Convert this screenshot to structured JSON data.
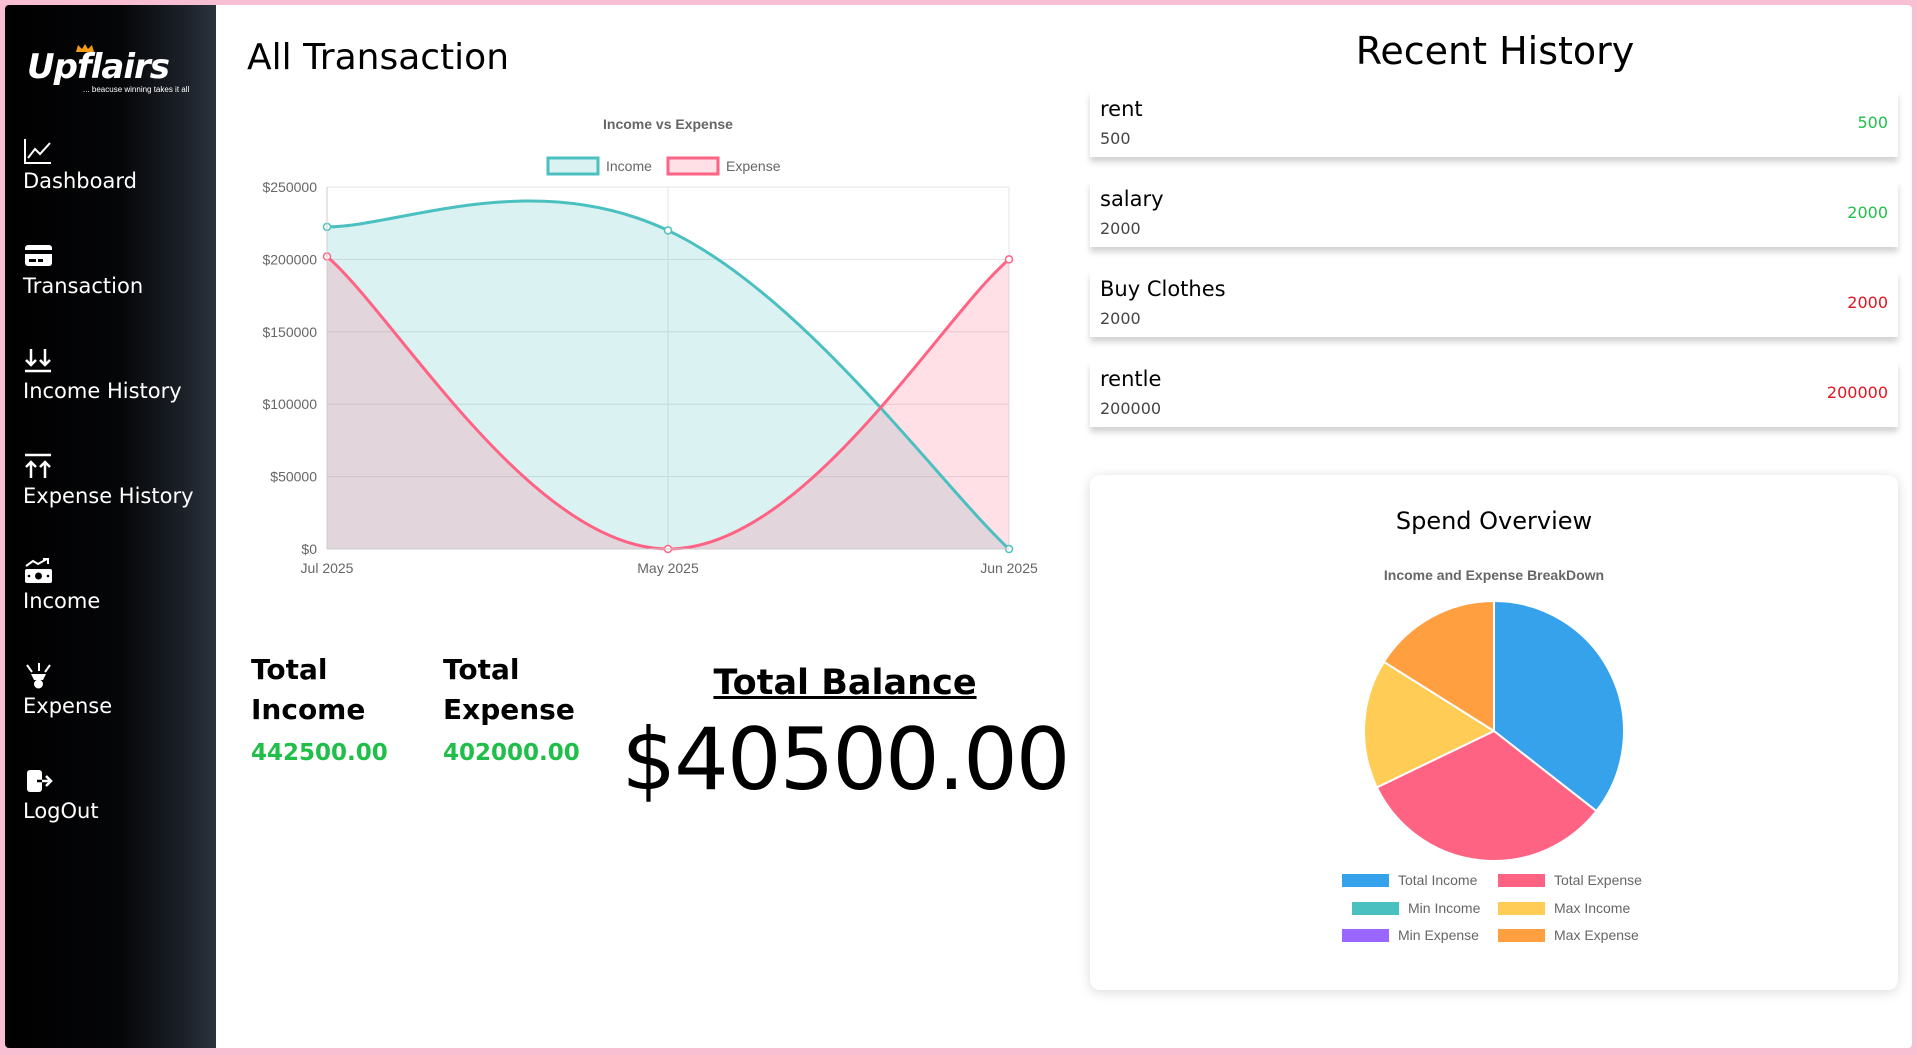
{
  "app": {
    "brand": "UpFlairs",
    "brand_display": "Upflairs",
    "tagline": "... beacuse winning takes it all"
  },
  "sidebar": {
    "items": [
      {
        "label": "Dashboard",
        "icon": "line-chart-icon"
      },
      {
        "label": "Transaction",
        "icon": "credit-card-icon"
      },
      {
        "label": "Income History",
        "icon": "download-arrows-icon"
      },
      {
        "label": "Expense History",
        "icon": "upload-arrows-icon"
      },
      {
        "label": "Income",
        "icon": "money-stack-icon"
      },
      {
        "label": "Expense",
        "icon": "hand-coins-icon"
      },
      {
        "label": "LogOut",
        "icon": "logout-icon"
      }
    ]
  },
  "main": {
    "title": "All Transaction",
    "totals": {
      "income_label": "Total Income",
      "income_value": "442500.00",
      "expense_label": "Total Expense",
      "expense_value": "402000.00",
      "balance_label": "Total Balance",
      "balance_value": "$40500.00"
    }
  },
  "chart_data": [
    {
      "type": "area",
      "title": "Income vs Expense",
      "categories": [
        "Jul 2025",
        "May 2025",
        "Jun 2025"
      ],
      "series": [
        {
          "name": "Income",
          "values": [
            222500,
            220000,
            0
          ],
          "color": "#4bc0c0"
        },
        {
          "name": "Expense",
          "values": [
            202000,
            0,
            200000
          ],
          "color": "#ff6384"
        }
      ],
      "ylim": [
        0,
        250000
      ],
      "yticks": [
        "$0",
        "$50000",
        "$100000",
        "$150000",
        "$200000",
        "$250000"
      ],
      "legend": "top",
      "grid": true
    },
    {
      "type": "pie",
      "title": "Income and Expense BreakDown",
      "categories": [
        "Total Income",
        "Total Expense",
        "Min Income",
        "Max Income",
        "Min Expense",
        "Max Expense"
      ],
      "values": [
        442500,
        402000,
        0,
        200000,
        0,
        200000
      ],
      "colors": [
        "#36a2eb",
        "#ff6384",
        "#4bc0c0",
        "#ffcd56",
        "#9966ff",
        "#ff9f40"
      ],
      "legend": "bottom"
    }
  ],
  "recent": {
    "title": "Recent History",
    "items": [
      {
        "name": "rent",
        "amount": "500",
        "right": "500",
        "type": "income",
        "color": "#1fbf4a"
      },
      {
        "name": "salary",
        "amount": "2000",
        "right": "2000",
        "type": "income",
        "color": "#1fbf4a"
      },
      {
        "name": "Buy Clothes",
        "amount": "2000",
        "right": "2000",
        "type": "expense",
        "color": "#e0141e"
      },
      {
        "name": "rentle",
        "amount": "200000",
        "right": "200000",
        "type": "expense",
        "color": "#e0141e"
      }
    ]
  },
  "overview": {
    "title": "Spend Overview"
  }
}
